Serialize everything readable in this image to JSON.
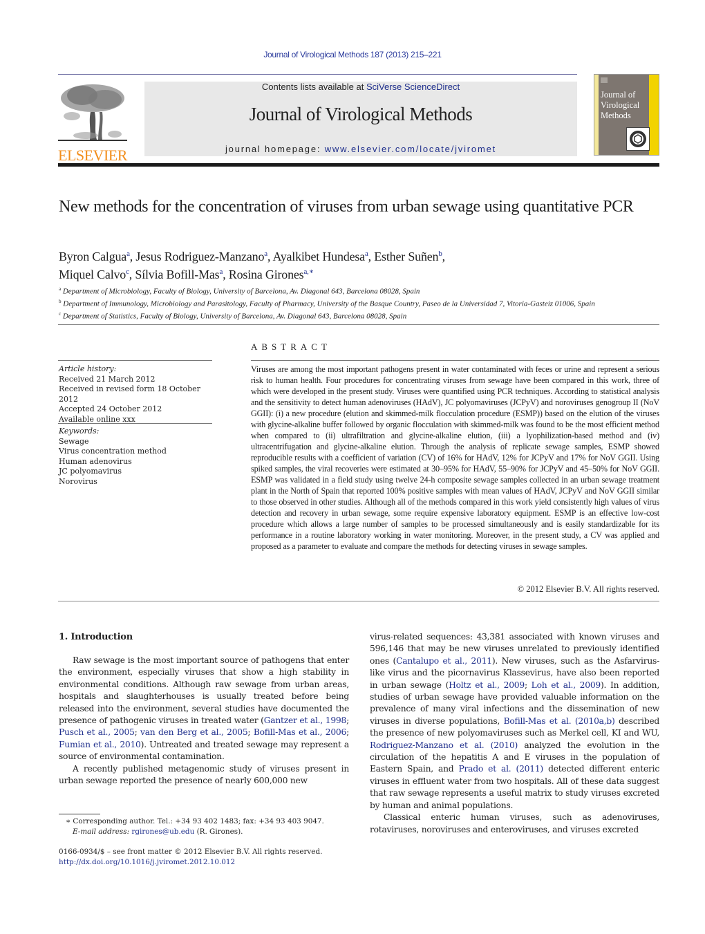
{
  "running_head": "Journal of Virological Methods 187 (2013) 215–221",
  "header": {
    "publisher_wordmark": "ELSEVIER",
    "contents_prefix": "Contents lists available at ",
    "contents_link": "SciVerse ScienceDirect",
    "journal_title": "Journal of Virological Methods",
    "homepage_prefix": "journal homepage: ",
    "homepage_link": "www.elsevier.com/locate/jviromet",
    "cover_title": "Journal of Virological Methods",
    "colors": {
      "link": "#1f2f8c",
      "wordmark": "#f28e1c",
      "banner_bg": "#e8e8e8",
      "cover_bg": "#7e7670",
      "cover_accent": "#f2d300"
    }
  },
  "article": {
    "title": "New methods for the concentration of viruses from urban sewage using quantitative PCR",
    "authors": [
      {
        "name": "Byron Calgua",
        "sup": "a",
        "sep": ", "
      },
      {
        "name": "Jesus Rodriguez-Manzano",
        "sup": "a",
        "sep": ", "
      },
      {
        "name": "Ayalkibet Hundesa",
        "sup": "a",
        "sep": ", "
      },
      {
        "name": "Esther Suñen",
        "sup": "b",
        "sep": ","
      },
      {
        "name": "Miquel Calvo",
        "sup": "c",
        "sep": ", "
      },
      {
        "name": "Sílvia Bofill-Mas",
        "sup": "a",
        "sep": ", "
      },
      {
        "name": "Rosina Girones",
        "sup": "a,∗",
        "sep": ""
      }
    ],
    "affiliations": [
      {
        "key": "a",
        "text": "Department of Microbiology, Faculty of Biology, University of Barcelona, Av. Diagonal 643, Barcelona 08028, Spain"
      },
      {
        "key": "b",
        "text": "Department of Immunology, Microbiology and Parasitology, Faculty of Pharmacy, University of the Basque Country, Paseo de la Universidad 7, Vitoria-Gasteiz 01006, Spain"
      },
      {
        "key": "c",
        "text": "Department of Statistics, Faculty of Biology, University of Barcelona, Av. Diagonal 643, Barcelona 08028, Spain"
      }
    ]
  },
  "article_info": {
    "history_label": "Article history:",
    "history": [
      "Received 21 March 2012",
      "Received in revised form 18 October 2012",
      "Accepted 24 October 2012",
      "Available online xxx"
    ],
    "keywords_label": "Keywords:",
    "keywords": [
      "Sewage",
      "Virus concentration method",
      "Human adenovirus",
      "JC polyomavirus",
      "Norovirus"
    ]
  },
  "abstract": {
    "heading": "ABSTRACT",
    "text": "Viruses are among the most important pathogens present in water contaminated with feces or urine and represent a serious risk to human health. Four procedures for concentrating viruses from sewage have been compared in this work, three of which were developed in the present study. Viruses were quantified using PCR techniques. According to statistical analysis and the sensitivity to detect human adenoviruses (HAdV), JC polyomaviruses (JCPyV) and noroviruses genogroup II (NoV GGII): (i) a new procedure (elution and skimmed-milk flocculation procedure (ESMP)) based on the elution of the viruses with glycine-alkaline buffer followed by organic flocculation with skimmed-milk was found to be the most efficient method when compared to (ii) ultrafiltration and glycine-alkaline elution, (iii) a lyophilization-based method and (iv) ultracentrifugation and glycine-alkaline elution. Through the analysis of replicate sewage samples, ESMP showed reproducible results with a coefficient of variation (CV) of 16% for HAdV, 12% for JCPyV and 17% for NoV GGII. Using spiked samples, the viral recoveries were estimated at 30–95% for HAdV, 55–90% for JCPyV and 45–50% for NoV GGII. ESMP was validated in a field study using twelve 24-h composite sewage samples collected in an urban sewage treatment plant in the North of Spain that reported 100% positive samples with mean values of HAdV, JCPyV and NoV GGII similar to those observed in other studies. Although all of the methods compared in this work yield consistently high values of virus detection and recovery in urban sewage, some require expensive laboratory equipment. ESMP is an effective low-cost procedure which allows a large number of samples to be processed simultaneously and is easily standardizable for its performance in a routine laboratory working in water monitoring. Moreover, in the present study, a CV was applied and proposed as a parameter to evaluate and compare the methods for detecting viruses in sewage samples.",
    "copyright": "© 2012 Elsevier B.V. All rights reserved."
  },
  "body": {
    "section_heading": "1.  Introduction",
    "left": {
      "p1_a": "Raw sewage is the most important source of pathogens that enter the environment, especially viruses that show a high stability in environmental conditions. Although raw sewage from urban areas, hospitals and slaughterhouses is usually treated before being released into the environment, several studies have documented the presence of pathogenic viruses in treated water (",
      "p1_cite1": "Gantzer et al., 1998",
      "p1_cite2": "Pusch et al., 2005",
      "p1_cite3": "van den Berg et al., 2005",
      "p1_cite4": "Bofill-Mas et al., 2006",
      "p1_cite5": "Fumian et al., 2010",
      "p1_b": "). Untreated and treated sewage may represent a source of environmental contamination.",
      "p2": "A recently published metagenomic study of viruses present in urban sewage reported the presence of nearly 600,000 new"
    },
    "right": {
      "p1_a": "virus-related sequences: 43,381 associated with known viruses and 596,146 that may be new viruses unrelated to previously identified ones (",
      "p1_cite1": "Cantalupo et al., 2011",
      "p1_b": "). New viruses, such as the Asfarvirus-like virus and the picornavirus Klassevirus, have also been reported in urban sewage (",
      "p1_cite2": "Holtz et al., 2009",
      "p1_cite3": "Loh et al., 2009",
      "p1_c": "). In addition, studies of urban sewage have provided valuable information on the prevalence of many viral infections and the dissemination of new viruses in diverse populations, ",
      "p1_cite4": "Bofill-Mas et al. (2010a,b)",
      "p1_d": " described the presence of new polyomaviruses such as Merkel cell, KI and WU, ",
      "p1_cite5": "Rodriguez-Manzano et al. (2010)",
      "p1_e": " analyzed the evolution in the circulation of the hepatitis A and E viruses in the population of Eastern Spain, and ",
      "p1_cite6": "Prado et al. (2011)",
      "p1_f": " detected different enteric viruses in effluent water from two hospitals. All of these data suggest that raw sewage represents a useful matrix to study viruses excreted by human and animal populations.",
      "p2": "Classical enteric human viruses, such as adenoviruses, rotaviruses, noroviruses and enteroviruses, and viruses excreted"
    }
  },
  "footnote": {
    "marker": "∗",
    "corresponding": "Corresponding author. Tel.: +34 93 402 1483; fax: +34 93 403 9047.",
    "email_label": "E-mail address:",
    "email": "rgirones@ub.edu",
    "email_suffix": " (R. Girones)."
  },
  "legal": {
    "front_matter": "0166-0934/$ – see front matter © 2012 Elsevier B.V. All rights reserved.",
    "doi": "http://dx.doi.org/10.1016/j.jviromet.2012.10.012"
  }
}
